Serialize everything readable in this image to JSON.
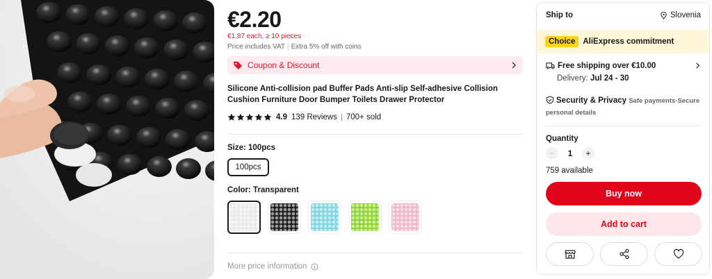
{
  "product": {
    "price": "€2.20",
    "price_each": "€1.87 each, ≥ 10 pieces",
    "vat_note": "Price includes VAT",
    "coins_note": "Extra 5% off with coins",
    "coupon_label": "Coupon & Discount",
    "title": "Silicone Anti-collision pad Buffer Pads Anti-slip Self-adhesive Collision Cushion Furniture Door Bumper Toilets Drawer Protector",
    "rating": {
      "stars": 5,
      "score": "4.9",
      "reviews": "139 Reviews",
      "sold": "700+ sold"
    },
    "size": {
      "label": "Size: 100pcs",
      "option": "100pcs"
    },
    "color": {
      "label": "Color: Transparent",
      "swatches": [
        {
          "name": "transparent",
          "color": "#e9e9e9",
          "selected": true
        },
        {
          "name": "black",
          "color": "#1e1e1e",
          "selected": false
        },
        {
          "name": "light-blue",
          "color": "#7fd4df",
          "selected": false
        },
        {
          "name": "green",
          "color": "#8fd42c",
          "selected": false
        },
        {
          "name": "pink",
          "color": "#f0b6c8",
          "selected": false
        }
      ]
    },
    "more_price_info": "More price information"
  },
  "sidebar": {
    "ship_to_label": "Ship to",
    "ship_to_location": "Slovenia",
    "choice_badge": "Choice",
    "choice_text": "AliExpress commitment",
    "free_shipping": "Free shipping over €10.00",
    "delivery_prefix": "Delivery: ",
    "delivery_dates": "Jul 24 - 30",
    "security_title": "Security & Privacy",
    "security_sub": "Safe payments·Secure",
    "security_sub2": "personal details",
    "quantity_label": "Quantity",
    "quantity_value": "1",
    "available": "759 available",
    "buy_now": "Buy now",
    "add_to_cart": "Add to cart"
  },
  "colors": {
    "accent_red": "#e0031b",
    "choice_yellow": "#ffd21d"
  }
}
